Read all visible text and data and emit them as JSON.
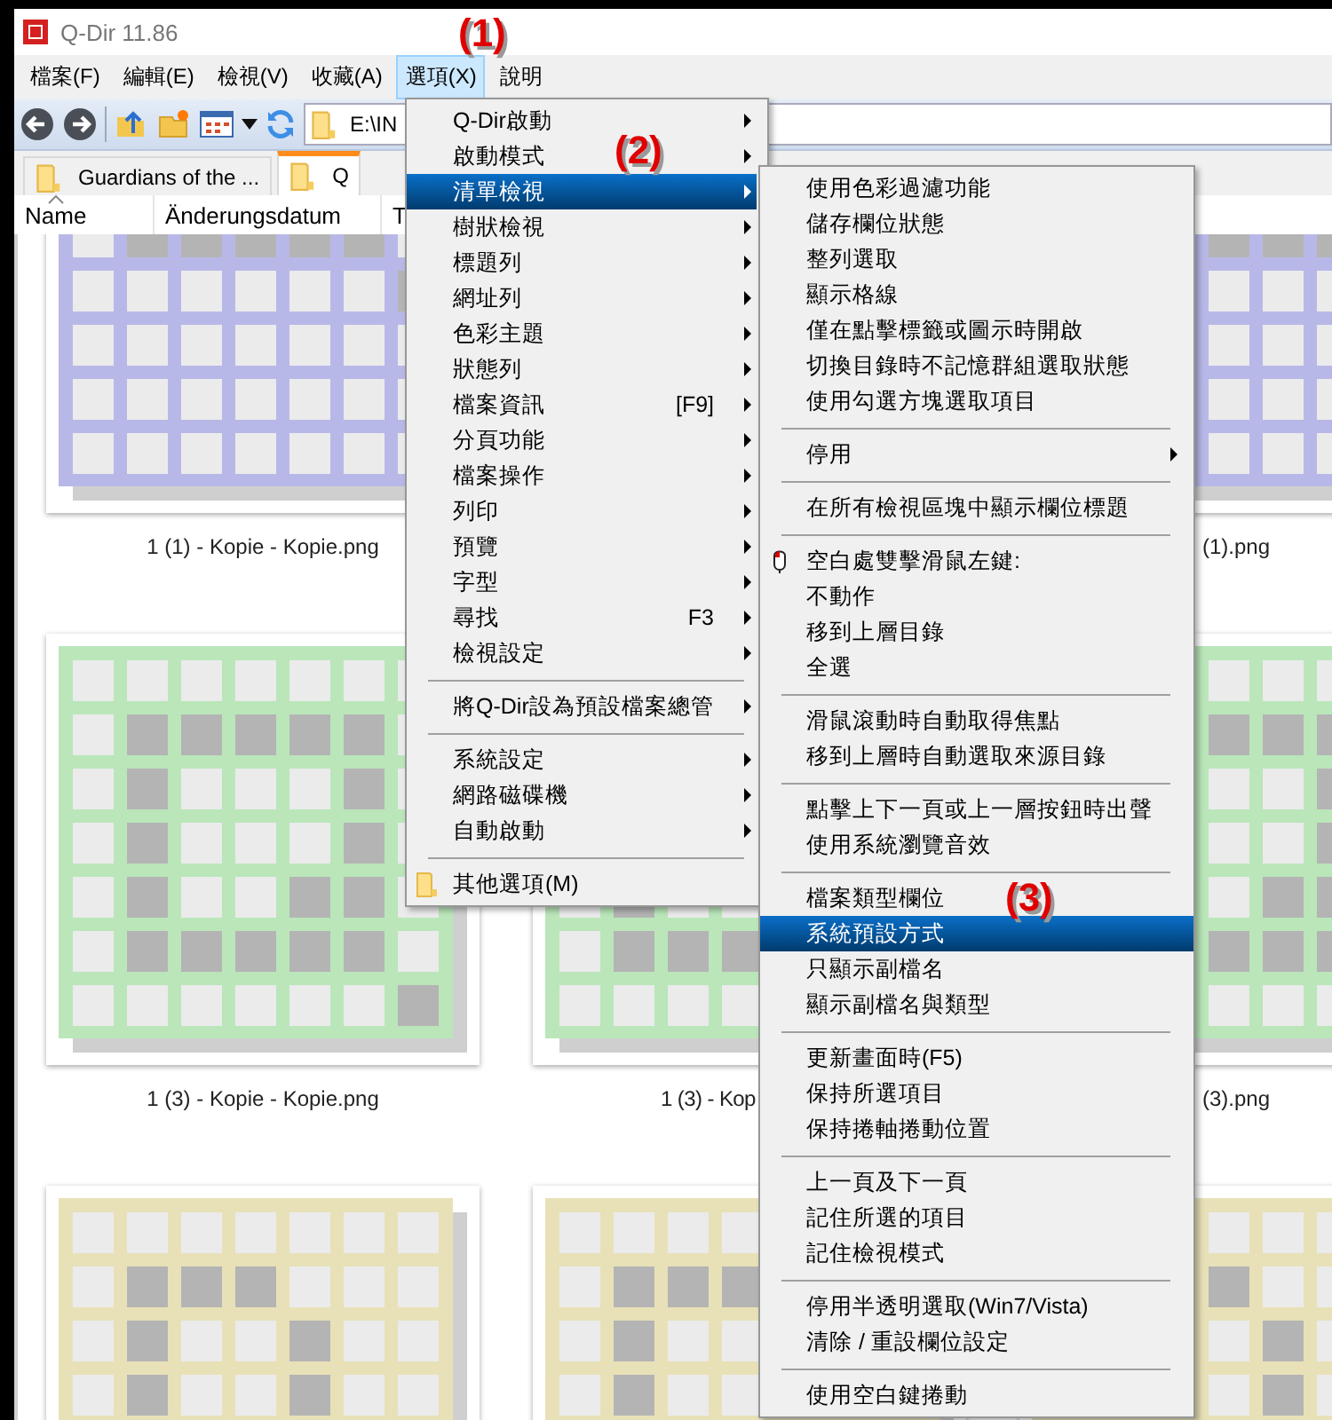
{
  "window": {
    "title": "Q-Dir 11.86"
  },
  "menu_bar": [
    {
      "label": "檔案(F)",
      "selected": false
    },
    {
      "label": "編輯(E)",
      "selected": false
    },
    {
      "label": "檢視(V)",
      "selected": false
    },
    {
      "label": "收藏(A)",
      "selected": false
    },
    {
      "label": "選項(X)",
      "selected": true
    },
    {
      "label": "說明",
      "selected": false
    }
  ],
  "toolbar": {
    "address": "E:\\IN"
  },
  "tabs": [
    {
      "label": "Guardians of the ...",
      "selected": false
    },
    {
      "label": "Q",
      "selected": true
    }
  ],
  "columns": [
    {
      "label": "Name",
      "sorted": true
    },
    {
      "label": "Änderungsdatum",
      "sorted": false
    },
    {
      "label": "T",
      "sorted": false
    }
  ],
  "thumbnails": [
    {
      "kind": "picture",
      "caption": "1 (1) - Kopie - Kopie.png"
    },
    {
      "kind": "covered"
    },
    {
      "kind": "picture",
      "caption": "(1).png"
    },
    {
      "kind": "picture",
      "caption": "1 (3) - Kopie - Kopie.png"
    },
    {
      "kind": "picture",
      "caption": "1 (3) - Kop"
    },
    {
      "kind": "picture",
      "caption": "(3).png"
    },
    {
      "kind": "picture"
    },
    {
      "kind": "picture"
    },
    {
      "kind": "picture"
    }
  ],
  "options_menu": {
    "items": [
      {
        "kind": "item",
        "label": "Q-Dir啟動",
        "has_submenu": true,
        "selected": false
      },
      {
        "kind": "item",
        "label": "啟動模式",
        "has_submenu": true,
        "selected": false
      },
      {
        "kind": "item",
        "label": "清單檢視",
        "has_submenu": true,
        "selected": true
      },
      {
        "kind": "item",
        "label": "樹狀檢視",
        "has_submenu": true,
        "selected": false
      },
      {
        "kind": "item",
        "label": "標題列",
        "has_submenu": true,
        "selected": false
      },
      {
        "kind": "item",
        "label": "網址列",
        "has_submenu": true,
        "selected": false
      },
      {
        "kind": "item",
        "label": "色彩主題",
        "has_submenu": true,
        "selected": false
      },
      {
        "kind": "item",
        "label": "狀態列",
        "has_submenu": true,
        "selected": false
      },
      {
        "kind": "item",
        "label": "檔案資訊",
        "shortcut": "[F9]",
        "has_submenu": true,
        "selected": false
      },
      {
        "kind": "item",
        "label": "分頁功能",
        "has_submenu": true,
        "selected": false
      },
      {
        "kind": "item",
        "label": "檔案操作",
        "has_submenu": true,
        "selected": false
      },
      {
        "kind": "item",
        "label": "列印",
        "has_submenu": true,
        "selected": false
      },
      {
        "kind": "item",
        "label": "預覽",
        "has_submenu": true,
        "selected": false
      },
      {
        "kind": "item",
        "label": "字型",
        "has_submenu": true,
        "selected": false
      },
      {
        "kind": "item",
        "label": "尋找",
        "shortcut": "F3",
        "has_submenu": true,
        "selected": false
      },
      {
        "kind": "item",
        "label": "檢視設定",
        "has_submenu": true,
        "selected": false
      },
      {
        "kind": "separator"
      },
      {
        "kind": "item",
        "label": "將Q-Dir設為預設檔案總管",
        "has_submenu": true,
        "selected": false
      },
      {
        "kind": "separator"
      },
      {
        "kind": "item",
        "label": "系統設定",
        "has_submenu": true,
        "selected": false
      },
      {
        "kind": "item",
        "label": "網路磁碟機",
        "has_submenu": true,
        "selected": false
      },
      {
        "kind": "item",
        "label": "自動啟動",
        "has_submenu": true,
        "selected": false
      },
      {
        "kind": "separator"
      },
      {
        "kind": "folder-item",
        "label": "其他選項(M)",
        "has_submenu": false,
        "selected": false
      }
    ]
  },
  "list_view_submenu": {
    "items": [
      {
        "kind": "item",
        "label": "使用色彩過濾功能",
        "has_submenu": false,
        "selected": false
      },
      {
        "kind": "item",
        "label": "儲存欄位狀態",
        "has_submenu": false,
        "selected": false
      },
      {
        "kind": "item",
        "label": "整列選取",
        "has_submenu": false,
        "selected": false
      },
      {
        "kind": "item",
        "label": "顯示格線",
        "has_submenu": false,
        "selected": false
      },
      {
        "kind": "item",
        "label": "僅在點擊標籤或圖示時開啟",
        "has_submenu": false,
        "selected": false
      },
      {
        "kind": "item",
        "label": "切換目錄時不記憶群組選取狀態",
        "has_submenu": false,
        "selected": false
      },
      {
        "kind": "item",
        "label": "使用勾選方塊選取項目",
        "has_submenu": false,
        "selected": false
      },
      {
        "kind": "separator"
      },
      {
        "kind": "item",
        "label": "停用",
        "has_submenu": true,
        "selected": false
      },
      {
        "kind": "separator"
      },
      {
        "kind": "item",
        "label": "在所有檢視區塊中顯示欄位標題",
        "has_submenu": false,
        "selected": false
      },
      {
        "kind": "separator"
      },
      {
        "kind": "mouse-item",
        "label": "空白處雙擊滑鼠左鍵:",
        "has_submenu": false,
        "selected": false
      },
      {
        "kind": "item",
        "label": "不動作",
        "has_submenu": false,
        "selected": false
      },
      {
        "kind": "item",
        "label": "移到上層目錄",
        "has_submenu": false,
        "selected": false
      },
      {
        "kind": "item",
        "label": "全選",
        "has_submenu": false,
        "selected": false
      },
      {
        "kind": "separator"
      },
      {
        "kind": "item",
        "label": "滑鼠滾動時自動取得焦點",
        "has_submenu": false,
        "selected": false
      },
      {
        "kind": "item",
        "label": "移到上層時自動選取來源目錄",
        "has_submenu": false,
        "selected": false
      },
      {
        "kind": "separator"
      },
      {
        "kind": "item",
        "label": "點擊上下一頁或上一層按鈕時出聲",
        "has_submenu": false,
        "selected": false
      },
      {
        "kind": "item",
        "label": "使用系統瀏覽音效",
        "has_submenu": false,
        "selected": false
      },
      {
        "kind": "separator"
      },
      {
        "kind": "item",
        "label": "檔案類型欄位",
        "has_submenu": false,
        "selected": false
      },
      {
        "kind": "item",
        "label": "系統預設方式",
        "has_submenu": false,
        "selected": true
      },
      {
        "kind": "item",
        "label": "只顯示副檔名",
        "has_submenu": false,
        "selected": false
      },
      {
        "kind": "item",
        "label": "顯示副檔名與類型",
        "has_submenu": false,
        "selected": false
      },
      {
        "kind": "separator"
      },
      {
        "kind": "item",
        "label": "更新畫面時(F5)",
        "has_submenu": false,
        "selected": false
      },
      {
        "kind": "item",
        "label": "保持所選項目",
        "has_submenu": false,
        "selected": false
      },
      {
        "kind": "item",
        "label": "保持捲軸捲動位置",
        "has_submenu": false,
        "selected": false
      },
      {
        "kind": "separator"
      },
      {
        "kind": "item",
        "label": "上一頁及下一頁",
        "has_submenu": false,
        "selected": false
      },
      {
        "kind": "item",
        "label": "記住所選的項目",
        "has_submenu": false,
        "selected": false
      },
      {
        "kind": "item",
        "label": "記住檢視模式",
        "has_submenu": false,
        "selected": false
      },
      {
        "kind": "separator"
      },
      {
        "kind": "item",
        "label": "停用半透明選取(Win7/Vista)",
        "has_submenu": false,
        "selected": false
      },
      {
        "kind": "item",
        "label": "清除 / 重設欄位設定",
        "has_submenu": false,
        "selected": false
      },
      {
        "kind": "separator"
      },
      {
        "kind": "item",
        "label": "使用空白鍵捲動",
        "has_submenu": false,
        "selected": false
      }
    ]
  },
  "annotations": [
    "(1)",
    "(2)",
    "(3)"
  ]
}
